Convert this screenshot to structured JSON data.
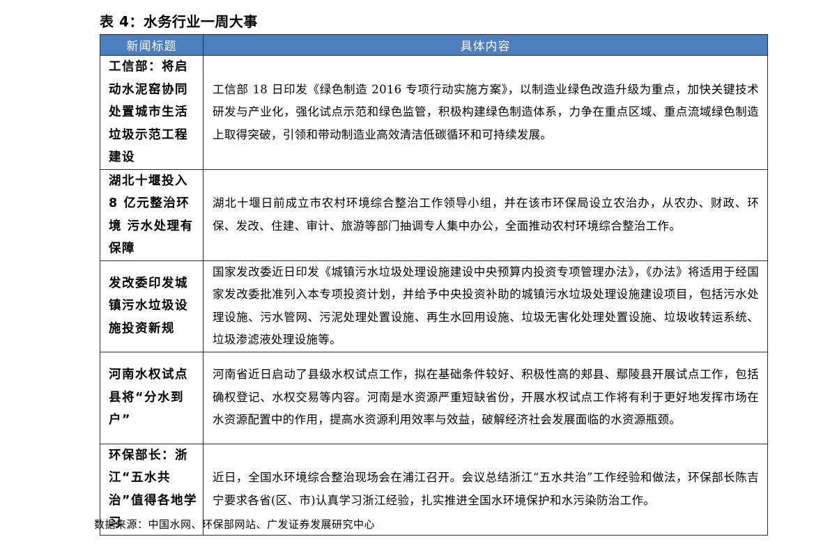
{
  "caption": "表 4：水务行业一周大事",
  "table": {
    "headers": [
      "新闻标题",
      "具体内容"
    ],
    "rows": [
      {
        "title": "工信部：将启动水泥窑协同处置城市生活垃圾示范工程建设",
        "content": "工信部 18 日印发《绿色制造 2016 专项行动实施方案》，以制造业绿色改造升级为重点，加快关键技术研发与产业化，强化试点示范和绿色监管，积极构建绿色制造体系，力争在重点区域、重点流域绿色制造上取得突破，引领和带动制造业高效清洁低碳循环和可持续发展。"
      },
      {
        "title": "湖北十堰投入 8 亿元整治环境 污水处理有保障",
        "content": "湖北十堰日前成立市农村环境综合整治工作领导小组，并在该市环保局设立农治办，从农办、财政、环保、发改、住建、审计、旅游等部门抽调专人集中办公，全面推动农村环境综合整治工作。"
      },
      {
        "title": "发改委印发城镇污水垃圾设施投资新规",
        "content": "国家发改委近日印发《城镇污水垃圾处理设施建设中央预算内投资专项管理办法》，《办法》将适用于经国家发改委批准列入本专项投资计划，并给予中央投资补助的城镇污水垃圾处理设施建设项目，包括污水处理设施、污水管网、污泥处理处置设施、再生水回用设施、垃圾无害化处理处置设施、垃圾收转运系统、垃圾渗滤液处理设施等。"
      },
      {
        "title": "河南水权试点县将“分水到户”",
        "content": "河南省近日启动了县级水权试点工作，拟在基础条件较好、积极性高的郏县、鄢陵县开展试点工作，包括确权登记、水权交易等内容。河南是水资源严重短缺省份，开展水权试点工作将有利于更好地发挥市场在水资源配置中的作用，提高水资源利用效率与效益，破解经济社会发展面临的水资源瓶颈。"
      },
      {
        "title": "环保部长：浙江“五水共治”值得各地学习",
        "content": "近日，全国水环境综合整治现场会在浦江召开。会议总结浙江“五水共治”工作经验和做法，环保部长陈吉宁要求各省(区、市)认真学习浙江经验，扎实推进全国水环境保护和水污染防治工作。"
      }
    ]
  },
  "source": "数据来源：中国水网、环保部网站、广发证券发展研究中心",
  "colors": {
    "header_background": "#4c7fbf",
    "header_text": "#ffffff",
    "border": "#2b2b2b"
  }
}
